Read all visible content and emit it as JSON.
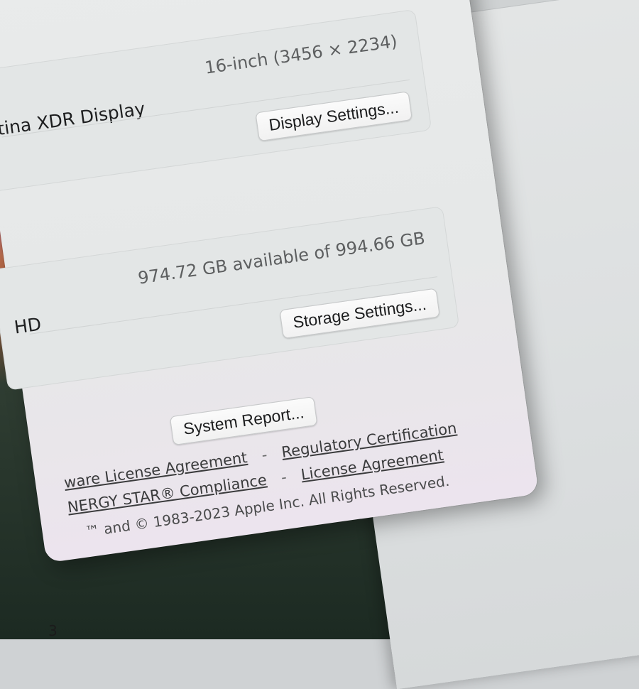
{
  "display": {
    "name": "etina XDR Display",
    "resolution": "16-inch (3456 × 2234)",
    "settings_button": "Display Settings..."
  },
  "storage": {
    "name": "HD",
    "capacity": "974.72 GB available of 994.66 GB",
    "settings_button": "Storage Settings..."
  },
  "system_report_button": "System Report...",
  "footer": {
    "row1": {
      "link_left": "ware License Agreement",
      "separator": "-",
      "link_right": "Regulatory Certification"
    },
    "row2": {
      "link_left": "NERGY STAR® Compliance",
      "separator": "-",
      "link_right": "License Agreement"
    },
    "copyright": "™ and © 1983-2023 Apple Inc. All Rights Reserved."
  },
  "page_marker": "3",
  "colors": {
    "window_bg": "#e9ebeb",
    "panel_bg": "#e3e6e6",
    "text_primary": "#1e1f20",
    "text_secondary": "#5d5f60"
  }
}
